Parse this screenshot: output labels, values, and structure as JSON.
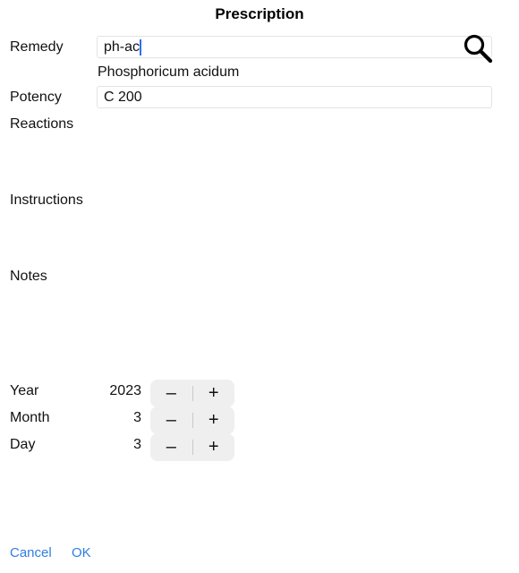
{
  "title": "Prescription",
  "remedy": {
    "label": "Remedy",
    "value": "ph-ac",
    "match": "Phosphoricum acidum",
    "search_icon": "search-icon"
  },
  "potency": {
    "label": "Potency",
    "value": "C 200"
  },
  "reactions": {
    "label": "Reactions"
  },
  "instructions": {
    "label": "Instructions"
  },
  "notes": {
    "label": "Notes"
  },
  "date": {
    "year": {
      "label": "Year",
      "value": "2023"
    },
    "month": {
      "label": "Month",
      "value": "3"
    },
    "day": {
      "label": "Day",
      "value": "3"
    },
    "decrement_symbol": "–",
    "increment_symbol": "+"
  },
  "footer": {
    "cancel_label": "Cancel",
    "ok_label": "OK"
  },
  "colors": {
    "accent": "#2f7de1",
    "caret": "#2e6cf6",
    "stepper_bg": "#efefef"
  }
}
